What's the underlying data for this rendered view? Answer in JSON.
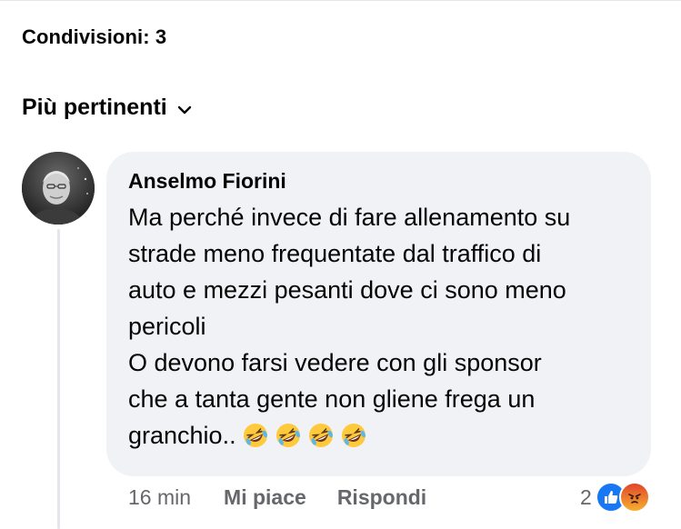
{
  "header": {
    "shares_label": "Condivisioni: 3",
    "sort_label": "Più pertinenti"
  },
  "comment": {
    "author": "Anselmo Fiorini",
    "text": "Ma perché invece di fare allenamento su\nstrade meno frequentate dal traffico di\nauto e mezzi pesanti dove ci sono meno\npericoli\nO devono farsi vedere con gli sponsor\nche a tanta gente non gliene frega un\ngranchio..",
    "emojis": [
      "rolling-on-floor-laughing",
      "rolling-on-floor-laughing",
      "rolling-on-floor-laughing",
      "rolling-on-floor-laughing"
    ],
    "time": "16 min",
    "like_label": "Mi piace",
    "reply_label": "Rispondi",
    "reaction_count": "2",
    "reactions": [
      "like",
      "angry"
    ]
  },
  "colors": {
    "bubble_bg": "#f0f2f5",
    "meta_text": "#65676b",
    "like_blue": "#1877f2",
    "angry_orange": "#f25c2b"
  }
}
